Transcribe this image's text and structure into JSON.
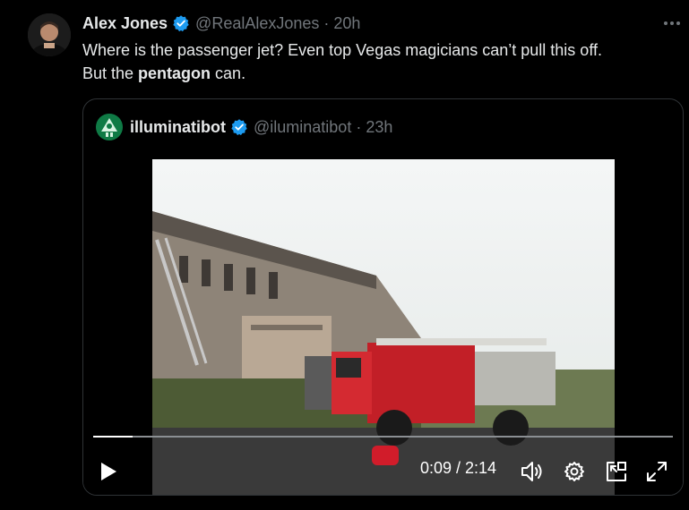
{
  "post": {
    "author_name": "Alex Jones",
    "handle": "@RealAlexJones",
    "separator": "·",
    "time": "20h",
    "text_line1": "Where is the passenger jet? Even top Vegas magicians can’t pull this off.",
    "text_line2_pre": "But the ",
    "text_line2_bold": "pentagon",
    "text_line2_post": " can."
  },
  "quoted": {
    "author_name": "illuminatibot",
    "handle": "@iluminatibot",
    "separator": "·",
    "time": "23h"
  },
  "video": {
    "timecode": "0:09 / 2:14",
    "progress": 0.068
  },
  "icons": {
    "verified": "verified-badge-icon",
    "more": "more-icon",
    "play": "play-icon",
    "volume": "volume-icon",
    "settings": "gear-icon",
    "pip": "picture-in-picture-icon",
    "fullscreen": "fullscreen-icon"
  },
  "colors": {
    "background": "#000000",
    "text": "#e7e9ea",
    "muted": "#71767b",
    "verified": "#1d9bf0",
    "border": "#2f3336"
  }
}
